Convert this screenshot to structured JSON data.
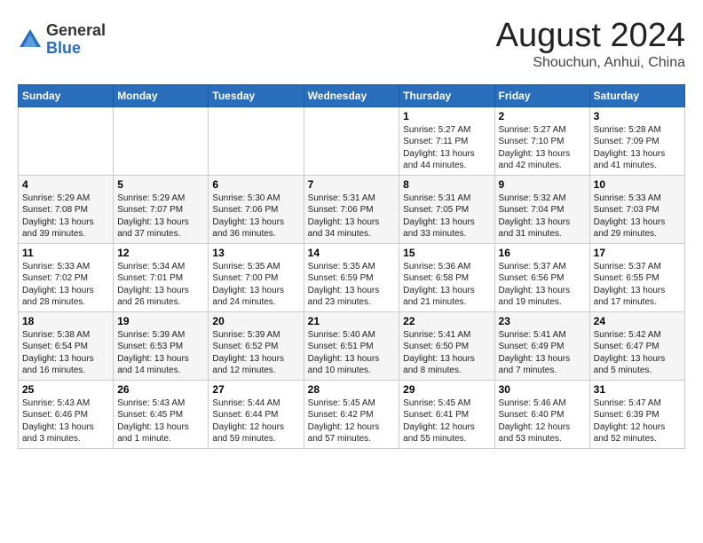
{
  "logo": {
    "general": "General",
    "blue": "Blue"
  },
  "title": {
    "month_year": "August 2024",
    "location": "Shouchun, Anhui, China"
  },
  "weekdays": [
    "Sunday",
    "Monday",
    "Tuesday",
    "Wednesday",
    "Thursday",
    "Friday",
    "Saturday"
  ],
  "weeks": [
    [
      {
        "day": "",
        "info": ""
      },
      {
        "day": "",
        "info": ""
      },
      {
        "day": "",
        "info": ""
      },
      {
        "day": "",
        "info": ""
      },
      {
        "day": "1",
        "info": "Sunrise: 5:27 AM\nSunset: 7:11 PM\nDaylight: 13 hours\nand 44 minutes."
      },
      {
        "day": "2",
        "info": "Sunrise: 5:27 AM\nSunset: 7:10 PM\nDaylight: 13 hours\nand 42 minutes."
      },
      {
        "day": "3",
        "info": "Sunrise: 5:28 AM\nSunset: 7:09 PM\nDaylight: 13 hours\nand 41 minutes."
      }
    ],
    [
      {
        "day": "4",
        "info": "Sunrise: 5:29 AM\nSunset: 7:08 PM\nDaylight: 13 hours\nand 39 minutes."
      },
      {
        "day": "5",
        "info": "Sunrise: 5:29 AM\nSunset: 7:07 PM\nDaylight: 13 hours\nand 37 minutes."
      },
      {
        "day": "6",
        "info": "Sunrise: 5:30 AM\nSunset: 7:06 PM\nDaylight: 13 hours\nand 36 minutes."
      },
      {
        "day": "7",
        "info": "Sunrise: 5:31 AM\nSunset: 7:06 PM\nDaylight: 13 hours\nand 34 minutes."
      },
      {
        "day": "8",
        "info": "Sunrise: 5:31 AM\nSunset: 7:05 PM\nDaylight: 13 hours\nand 33 minutes."
      },
      {
        "day": "9",
        "info": "Sunrise: 5:32 AM\nSunset: 7:04 PM\nDaylight: 13 hours\nand 31 minutes."
      },
      {
        "day": "10",
        "info": "Sunrise: 5:33 AM\nSunset: 7:03 PM\nDaylight: 13 hours\nand 29 minutes."
      }
    ],
    [
      {
        "day": "11",
        "info": "Sunrise: 5:33 AM\nSunset: 7:02 PM\nDaylight: 13 hours\nand 28 minutes."
      },
      {
        "day": "12",
        "info": "Sunrise: 5:34 AM\nSunset: 7:01 PM\nDaylight: 13 hours\nand 26 minutes."
      },
      {
        "day": "13",
        "info": "Sunrise: 5:35 AM\nSunset: 7:00 PM\nDaylight: 13 hours\nand 24 minutes."
      },
      {
        "day": "14",
        "info": "Sunrise: 5:35 AM\nSunset: 6:59 PM\nDaylight: 13 hours\nand 23 minutes."
      },
      {
        "day": "15",
        "info": "Sunrise: 5:36 AM\nSunset: 6:58 PM\nDaylight: 13 hours\nand 21 minutes."
      },
      {
        "day": "16",
        "info": "Sunrise: 5:37 AM\nSunset: 6:56 PM\nDaylight: 13 hours\nand 19 minutes."
      },
      {
        "day": "17",
        "info": "Sunrise: 5:37 AM\nSunset: 6:55 PM\nDaylight: 13 hours\nand 17 minutes."
      }
    ],
    [
      {
        "day": "18",
        "info": "Sunrise: 5:38 AM\nSunset: 6:54 PM\nDaylight: 13 hours\nand 16 minutes."
      },
      {
        "day": "19",
        "info": "Sunrise: 5:39 AM\nSunset: 6:53 PM\nDaylight: 13 hours\nand 14 minutes."
      },
      {
        "day": "20",
        "info": "Sunrise: 5:39 AM\nSunset: 6:52 PM\nDaylight: 13 hours\nand 12 minutes."
      },
      {
        "day": "21",
        "info": "Sunrise: 5:40 AM\nSunset: 6:51 PM\nDaylight: 13 hours\nand 10 minutes."
      },
      {
        "day": "22",
        "info": "Sunrise: 5:41 AM\nSunset: 6:50 PM\nDaylight: 13 hours\nand 8 minutes."
      },
      {
        "day": "23",
        "info": "Sunrise: 5:41 AM\nSunset: 6:49 PM\nDaylight: 13 hours\nand 7 minutes."
      },
      {
        "day": "24",
        "info": "Sunrise: 5:42 AM\nSunset: 6:47 PM\nDaylight: 13 hours\nand 5 minutes."
      }
    ],
    [
      {
        "day": "25",
        "info": "Sunrise: 5:43 AM\nSunset: 6:46 PM\nDaylight: 13 hours\nand 3 minutes."
      },
      {
        "day": "26",
        "info": "Sunrise: 5:43 AM\nSunset: 6:45 PM\nDaylight: 13 hours\nand 1 minute."
      },
      {
        "day": "27",
        "info": "Sunrise: 5:44 AM\nSunset: 6:44 PM\nDaylight: 12 hours\nand 59 minutes."
      },
      {
        "day": "28",
        "info": "Sunrise: 5:45 AM\nSunset: 6:42 PM\nDaylight: 12 hours\nand 57 minutes."
      },
      {
        "day": "29",
        "info": "Sunrise: 5:45 AM\nSunset: 6:41 PM\nDaylight: 12 hours\nand 55 minutes."
      },
      {
        "day": "30",
        "info": "Sunrise: 5:46 AM\nSunset: 6:40 PM\nDaylight: 12 hours\nand 53 minutes."
      },
      {
        "day": "31",
        "info": "Sunrise: 5:47 AM\nSunset: 6:39 PM\nDaylight: 12 hours\nand 52 minutes."
      }
    ]
  ]
}
